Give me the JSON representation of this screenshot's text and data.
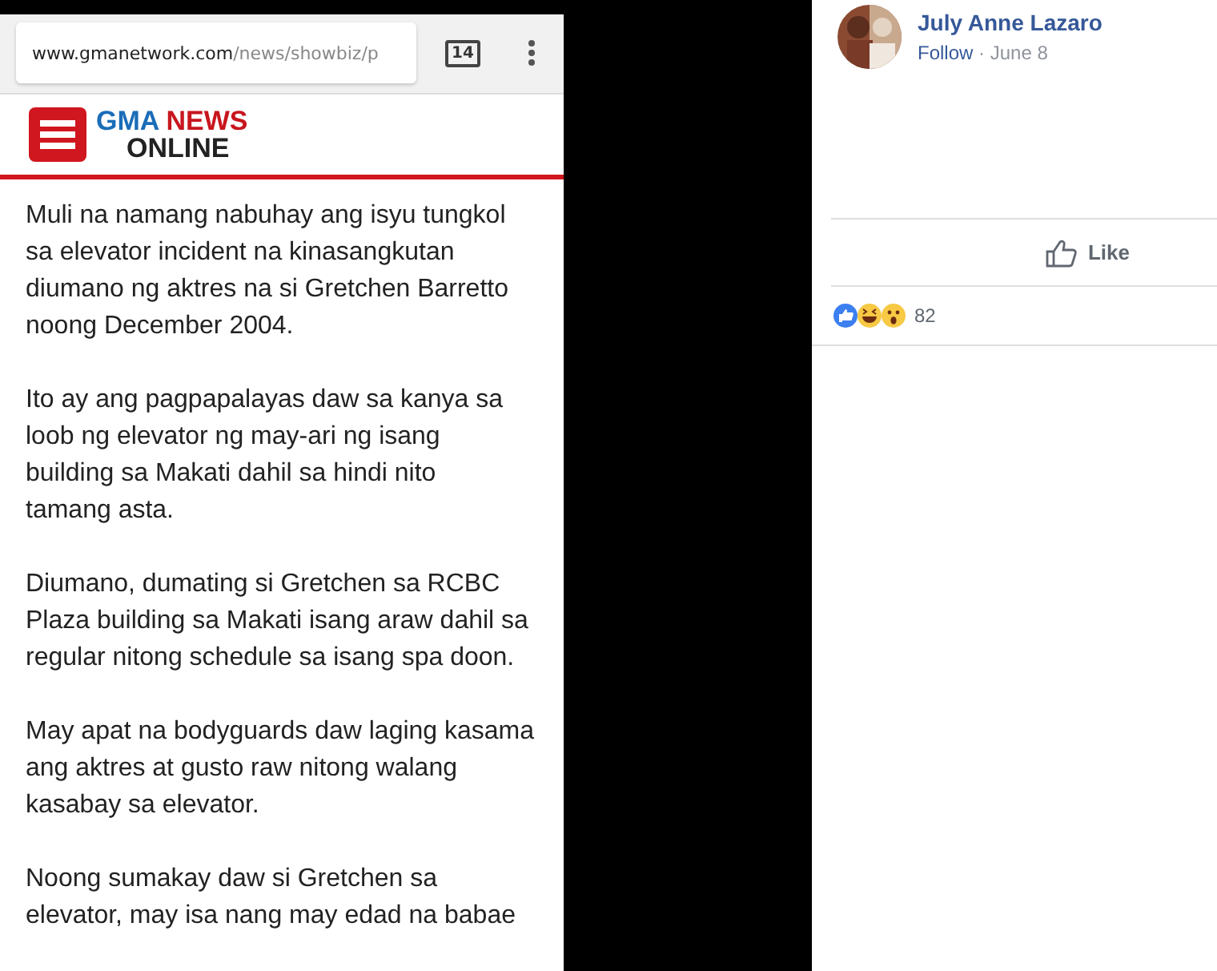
{
  "browser": {
    "url_domain": "www.gmanetwork.com",
    "url_path": "/news/showbiz/p",
    "tab_count": "14"
  },
  "site": {
    "logo_top": "GMA",
    "logo_news": "NEWS",
    "logo_bottom": "ONLINE"
  },
  "article": {
    "paragraphs": [
      {
        "lines": [
          "Muli na namang nabuhay ang isyu tungkol",
          "sa elevator incident na kinasangkutan",
          "diumano ng aktres na si Gretchen Barretto",
          "noong December 2004."
        ]
      },
      {
        "lines": [
          "Ito ay ang pagpapalayas daw sa kanya sa",
          "loob ng elevator ng may-ari ng isang",
          "building sa Makati dahil sa hindi nito",
          "tamang asta."
        ]
      },
      {
        "lines": [
          "Diumano, dumating si Gretchen sa RCBC",
          "Plaza building sa Makati isang araw dahil sa",
          "regular nitong schedule sa isang spa doon."
        ]
      },
      {
        "lines": [
          "May apat na bodyguards daw laging kasama",
          "ang aktres at gusto raw nitong walang",
          "kasabay sa elevator."
        ]
      },
      {
        "lines": [
          "Noong sumakay daw si Gretchen sa",
          "elevator, may isa nang may edad na babae"
        ]
      }
    ]
  },
  "post": {
    "author": "July Anne Lazaro",
    "follow": "Follow",
    "separator": "·",
    "date": "June 8",
    "like_label": "Like",
    "reaction_count": "82"
  }
}
